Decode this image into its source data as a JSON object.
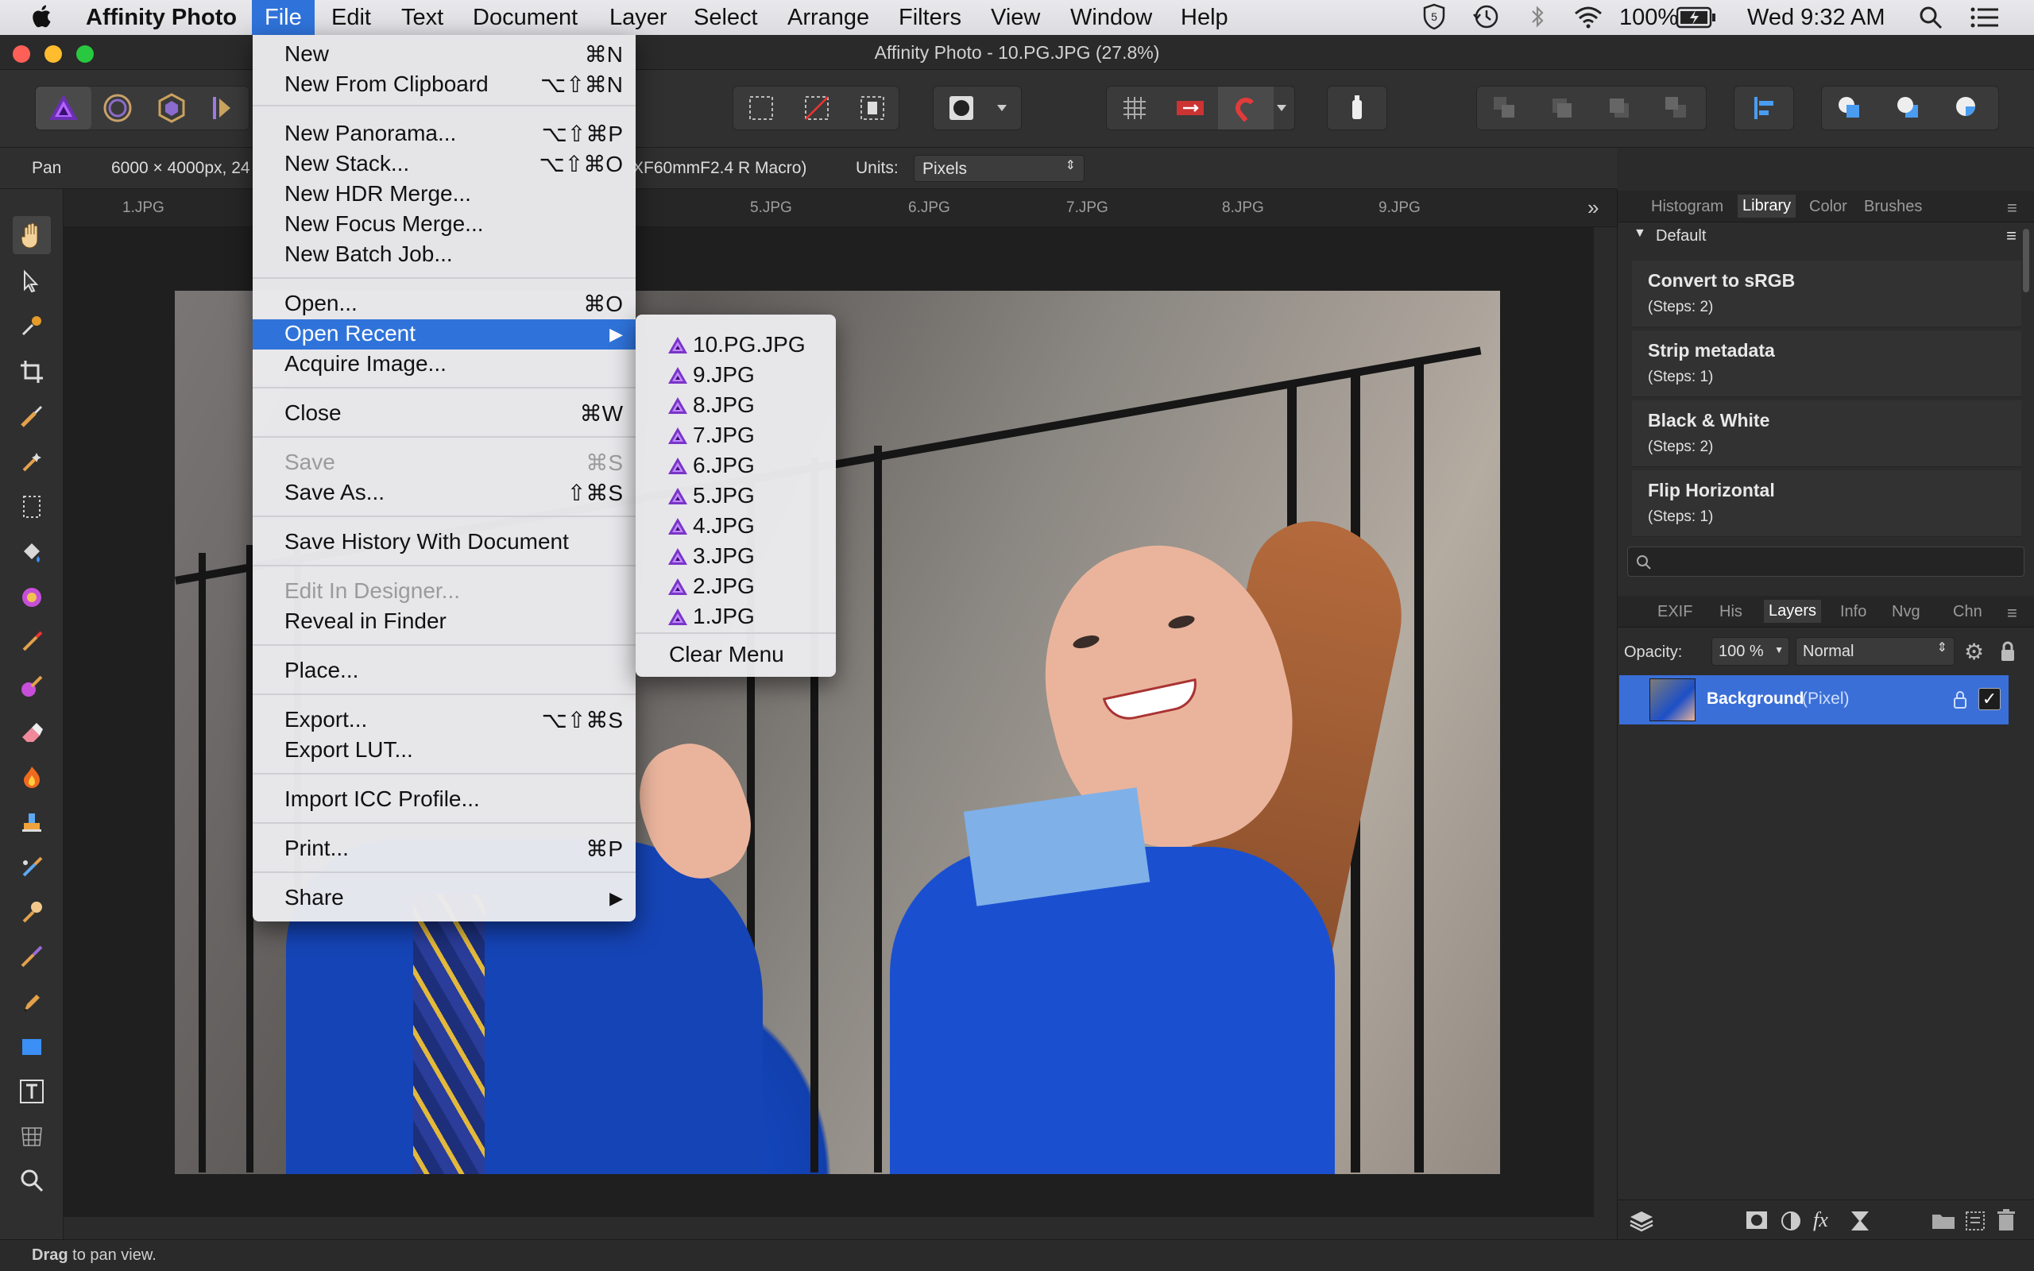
{
  "menubar": {
    "app": "Affinity Photo",
    "items": [
      "File",
      "Edit",
      "Text",
      "Document",
      "Layer",
      "Select",
      "Arrange",
      "Filters",
      "View",
      "Window",
      "Help"
    ],
    "battery": "100%",
    "clock": "Wed 9:32 AM"
  },
  "window": {
    "title": "Affinity Photo - 10.PG.JPG (27.8%)"
  },
  "context": {
    "tool": "Pan",
    "info": "6000 × 4000px, 24",
    "lens": "XF60mmF2.4 R Macro)",
    "units_label": "Units:",
    "units_value": "Pixels"
  },
  "tabs": [
    "1.JPG",
    "5.JPG",
    "6.JPG",
    "7.JPG",
    "8.JPG",
    "9.JPG"
  ],
  "file_menu": [
    {
      "label": "New",
      "key": "⌘N"
    },
    {
      "label": "New From Clipboard",
      "key": "⌥⇧⌘N"
    },
    {
      "label": "New Panorama...",
      "key": "⌥⇧⌘P"
    },
    {
      "label": "New Stack...",
      "key": "⌥⇧⌘O"
    },
    {
      "label": "New HDR Merge...",
      "key": ""
    },
    {
      "label": "New Focus Merge...",
      "key": ""
    },
    {
      "label": "New Batch Job...",
      "key": ""
    },
    {
      "label": "Open...",
      "key": "⌘O"
    },
    {
      "label": "Open Recent",
      "key": "▶"
    },
    {
      "label": "Acquire Image...",
      "key": ""
    },
    {
      "label": "Close",
      "key": "⌘W"
    },
    {
      "label": "Save",
      "key": "⌘S"
    },
    {
      "label": "Save As...",
      "key": "⇧⌘S"
    },
    {
      "label": "Save History With Document",
      "key": ""
    },
    {
      "label": "Edit In Designer...",
      "key": ""
    },
    {
      "label": "Reveal in Finder",
      "key": ""
    },
    {
      "label": "Place...",
      "key": ""
    },
    {
      "label": "Export...",
      "key": "⌥⇧⌘S"
    },
    {
      "label": "Export LUT...",
      "key": ""
    },
    {
      "label": "Import ICC Profile...",
      "key": ""
    },
    {
      "label": "Print...",
      "key": "⌘P"
    },
    {
      "label": "Share",
      "key": "▶"
    }
  ],
  "recent_menu": {
    "items": [
      "10.PG.JPG",
      "9.JPG",
      "8.JPG",
      "7.JPG",
      "6.JPG",
      "5.JPG",
      "4.JPG",
      "3.JPG",
      "2.JPG",
      "1.JPG"
    ],
    "clear": "Clear Menu"
  },
  "library_panel": {
    "tabs": [
      "Histogram",
      "Library",
      "Color",
      "Brushes"
    ],
    "group": "Default",
    "macros": [
      {
        "name": "Convert to sRGB",
        "steps": "(Steps: 2)"
      },
      {
        "name": "Strip metadata",
        "steps": "(Steps: 1)"
      },
      {
        "name": "Black & White",
        "steps": "(Steps: 2)"
      },
      {
        "name": "Flip Horizontal",
        "steps": "(Steps: 1)"
      }
    ]
  },
  "layers_panel": {
    "tabs": [
      "EXIF",
      "His",
      "Layers",
      "Info",
      "Nvg",
      "Chn"
    ],
    "opacity_label": "Opacity:",
    "opacity_value": "100 %",
    "blend_mode": "Normal",
    "layer_name": "Background",
    "layer_type": "(Pixel)"
  },
  "status": {
    "bold": "Drag",
    "text": " to pan view."
  },
  "colors": {
    "accent": "#2f73da",
    "layer_selected": "#3b6fd8"
  }
}
